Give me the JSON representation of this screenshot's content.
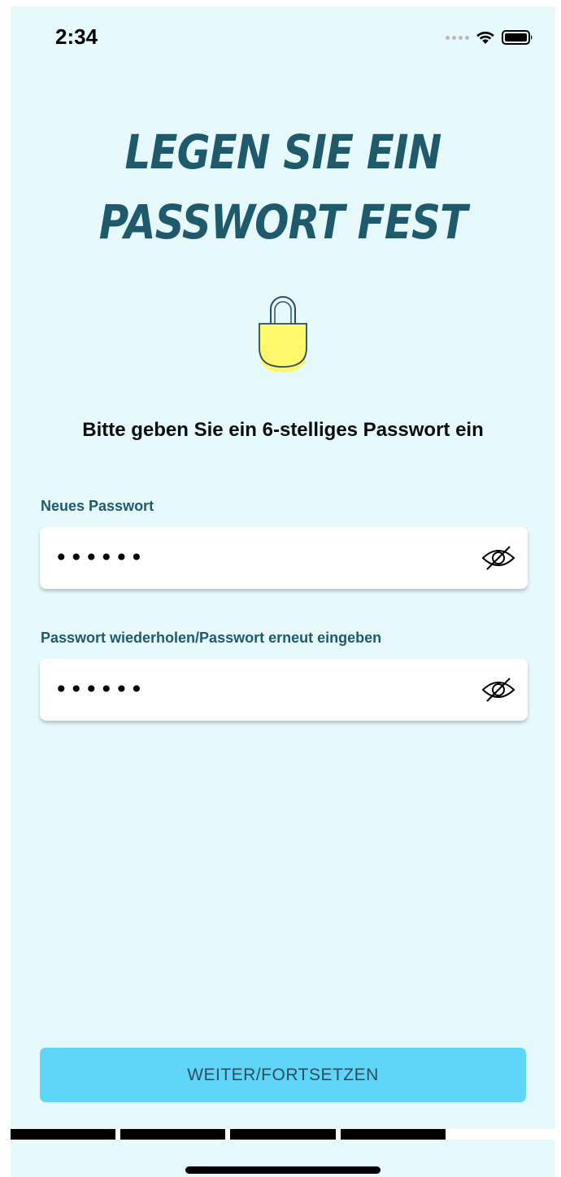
{
  "status_bar": {
    "time": "2:34",
    "icons": [
      "signal-dots-icon",
      "wifi-icon",
      "battery-icon"
    ]
  },
  "header": {
    "title_line1": "LEGEN SIE EIN",
    "title_line2": "PASSWORT FEST"
  },
  "hero_icon": "padlock-icon",
  "colors": {
    "background": "#e6fafd",
    "title": "#1f5a6c",
    "accent_yellow": "#fdf76b",
    "button": "#5fd5f7"
  },
  "instruction": "Bitte geben Sie ein 6-stelliges Passwort ein",
  "form": {
    "new_password": {
      "label": "Neues Passwort",
      "value": "••••••",
      "toggle_icon": "eye-slash-icon"
    },
    "repeat_password": {
      "label": "Passwort wiederholen/Passwort erneut eingeben",
      "value": "••••••",
      "toggle_icon": "eye-slash-icon"
    }
  },
  "continue_button": {
    "label": "WEITER/FORTSETZEN"
  },
  "progress": {
    "total_steps": 5,
    "completed_steps": 4
  }
}
